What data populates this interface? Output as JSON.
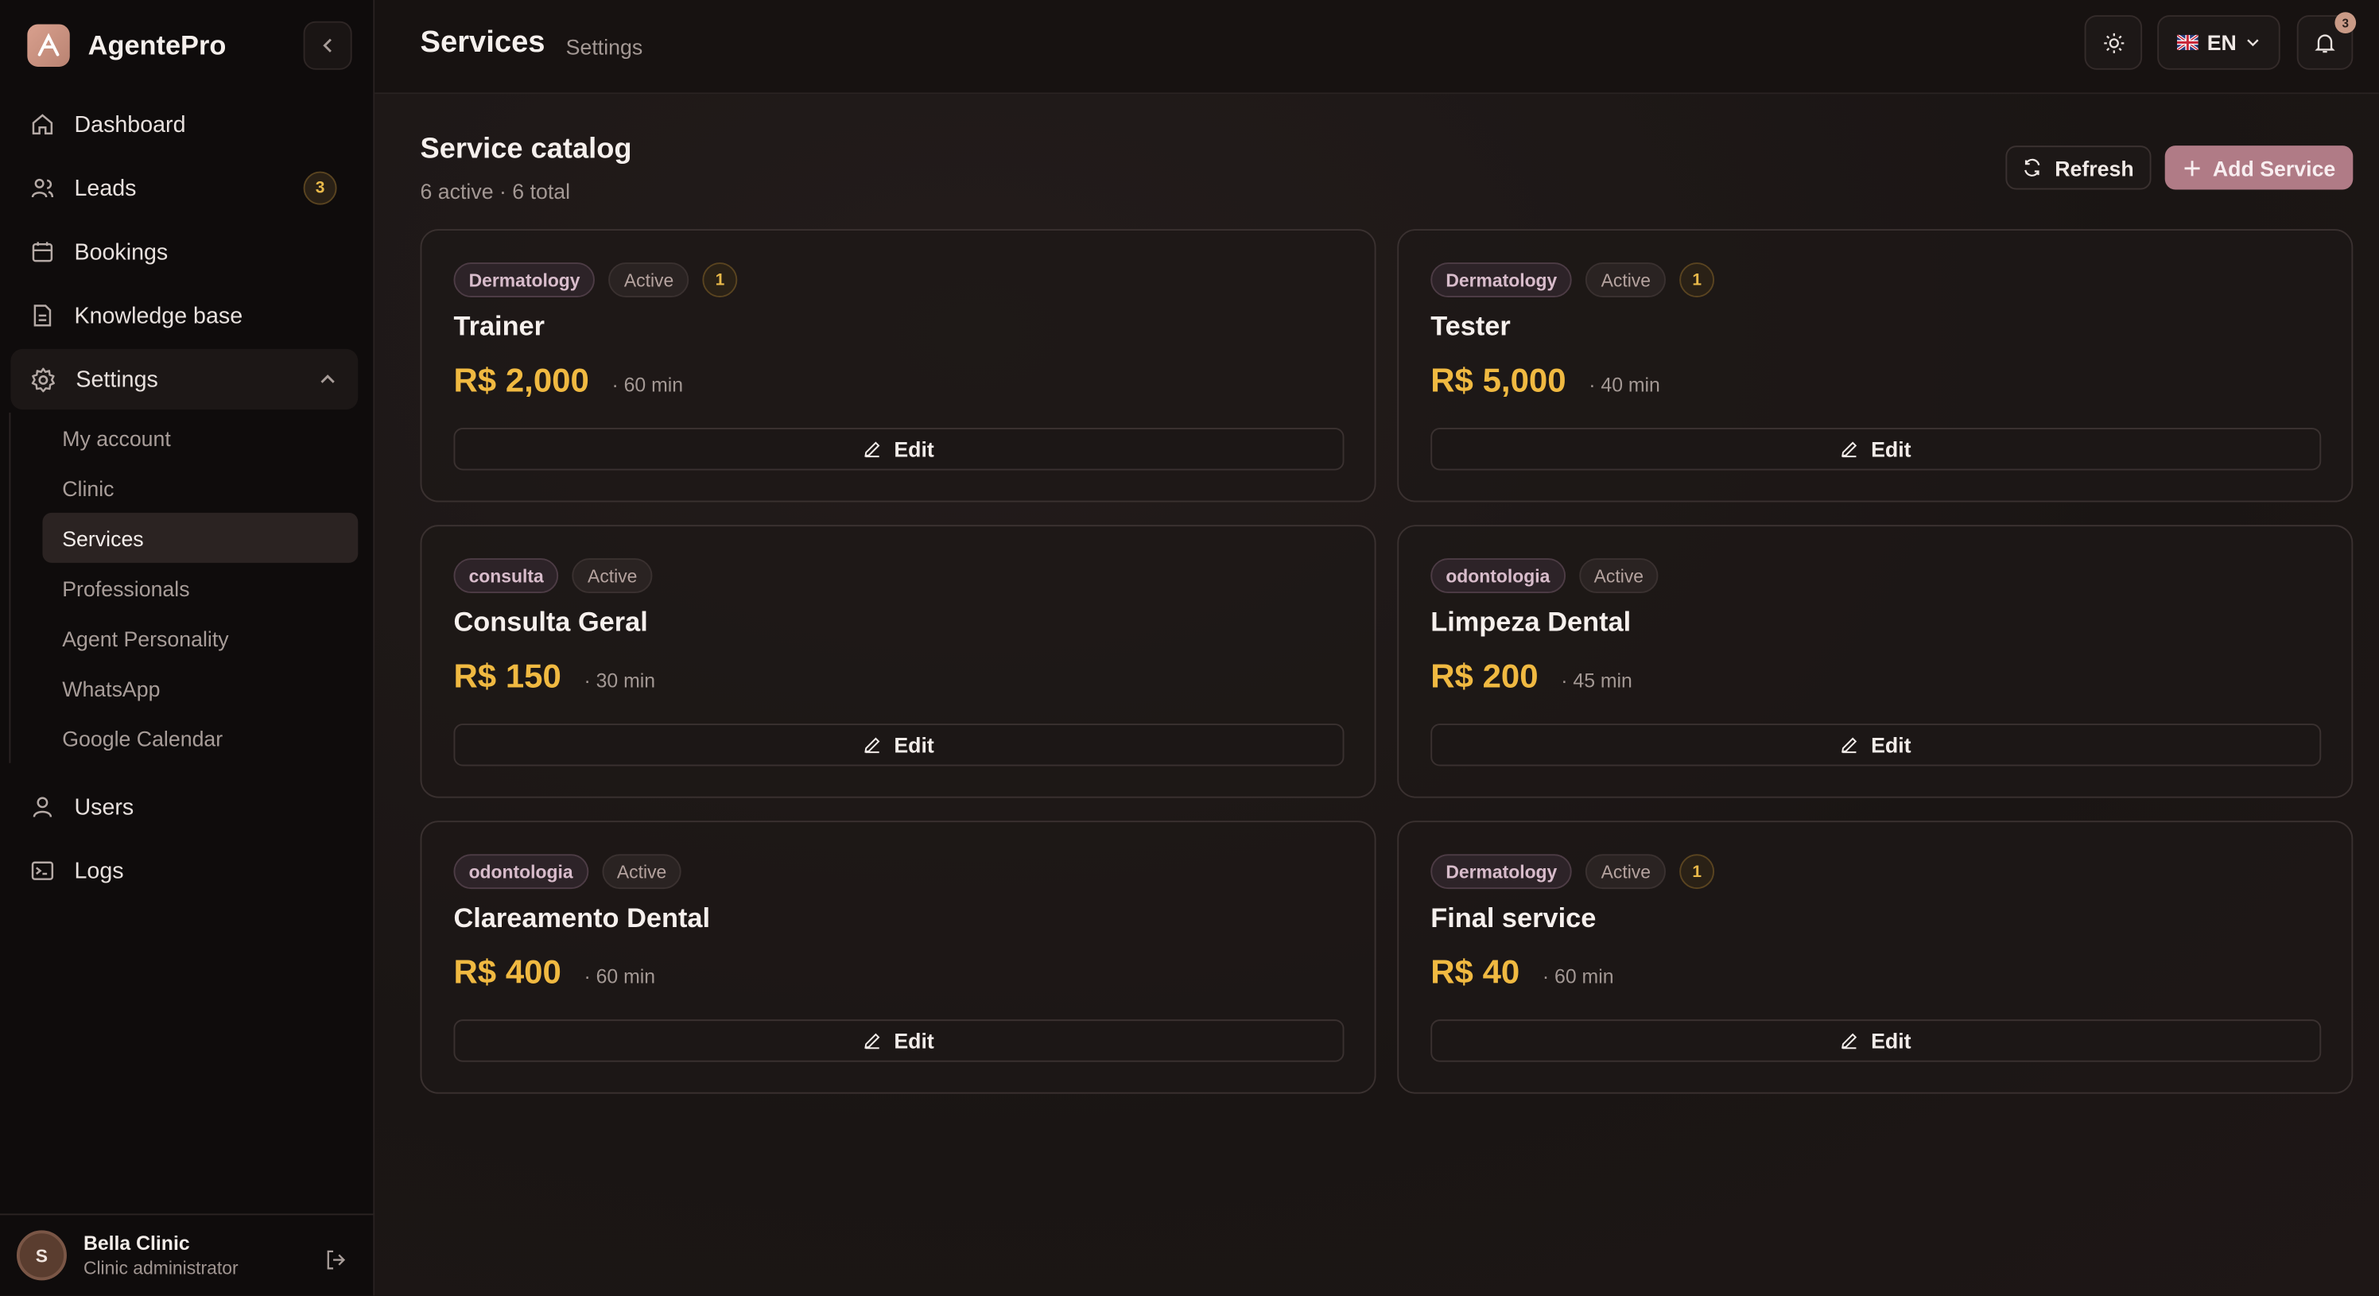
{
  "app": {
    "name": "AgentePro"
  },
  "sidebar": {
    "items": [
      {
        "label": "Dashboard",
        "icon": "home-icon"
      },
      {
        "label": "Leads",
        "icon": "users-icon",
        "badge": "3"
      },
      {
        "label": "Bookings",
        "icon": "calendar-icon"
      },
      {
        "label": "Knowledge base",
        "icon": "document-icon"
      },
      {
        "label": "Settings",
        "icon": "gear-icon"
      }
    ],
    "settings_sub": [
      {
        "label": "My account"
      },
      {
        "label": "Clinic"
      },
      {
        "label": "Services"
      },
      {
        "label": "Professionals"
      },
      {
        "label": "Agent Personality"
      },
      {
        "label": "WhatsApp"
      },
      {
        "label": "Google Calendar"
      }
    ],
    "items2": [
      {
        "label": "Users",
        "icon": "user-icon"
      },
      {
        "label": "Logs",
        "icon": "terminal-icon"
      }
    ],
    "user": {
      "initial": "S",
      "name": "Bella Clinic",
      "role": "Clinic administrator"
    }
  },
  "header": {
    "title": "Services",
    "breadcrumb": "Settings",
    "language": "EN",
    "notifications": "3"
  },
  "main": {
    "title": "Service catalog",
    "subtitle": "6 active · 6 total",
    "refresh_label": "Refresh",
    "add_label": "Add Service",
    "edit_label": "Edit",
    "services": [
      {
        "category": "Dermatology",
        "status": "Active",
        "count": "1",
        "name": "Trainer",
        "price": "R$ 2,000",
        "duration": "· 60 min"
      },
      {
        "category": "Dermatology",
        "status": "Active",
        "count": "1",
        "name": "Tester",
        "price": "R$ 5,000",
        "duration": "· 40 min"
      },
      {
        "category": "consulta",
        "status": "Active",
        "name": "Consulta Geral",
        "price": "R$ 150",
        "duration": "· 30 min"
      },
      {
        "category": "odontologia",
        "status": "Active",
        "name": "Limpeza Dental",
        "price": "R$ 200",
        "duration": "· 45 min"
      },
      {
        "category": "odontologia",
        "status": "Active",
        "name": "Clareamento Dental",
        "price": "R$ 400",
        "duration": "· 60 min"
      },
      {
        "category": "Dermatology",
        "status": "Active",
        "count": "1",
        "name": "Final service",
        "price": "R$ 40",
        "duration": "· 60 min"
      }
    ]
  },
  "colors": {
    "accent": "#b07b86",
    "price": "#f0b941",
    "background": "#1a1514"
  }
}
